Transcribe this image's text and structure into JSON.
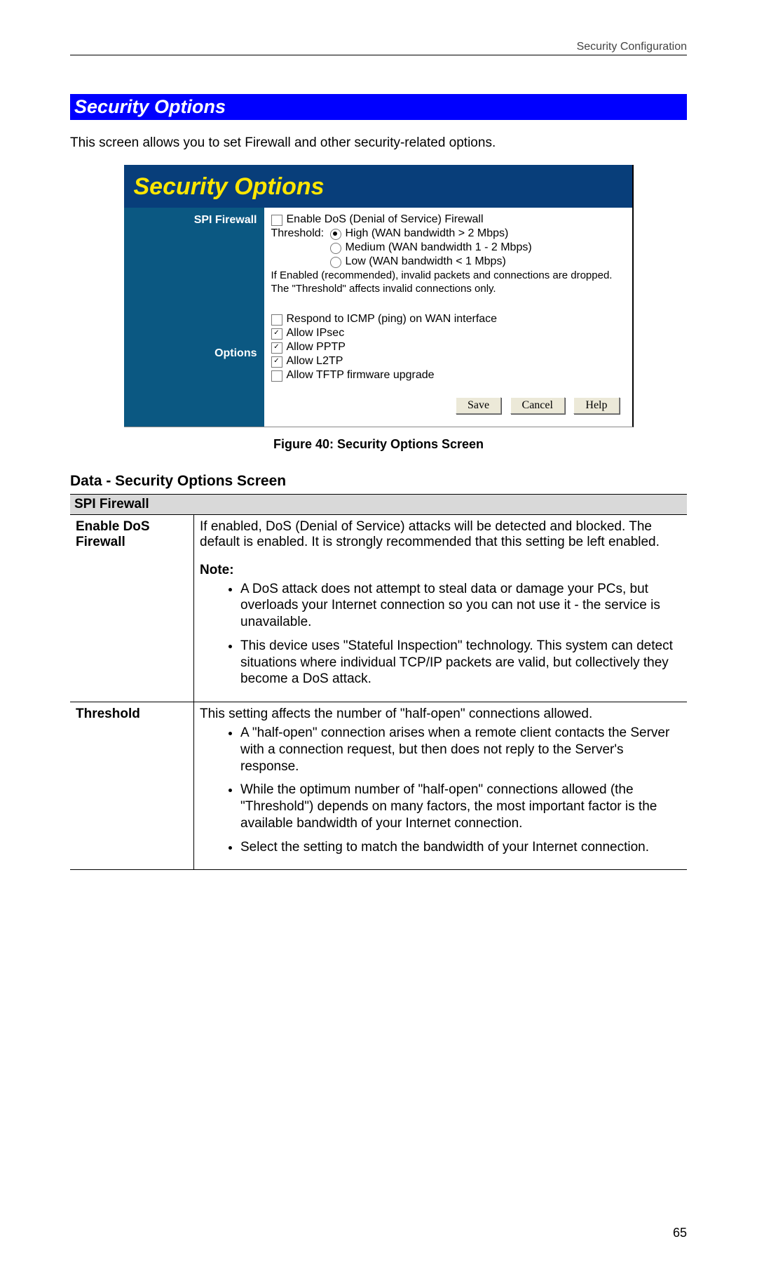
{
  "header": {
    "chapter": "Security Configuration"
  },
  "section_title": "Security Options",
  "intro": "This screen allows you to set Firewall and other security-related options.",
  "screencap": {
    "title": "Security Options",
    "left": {
      "row1": "SPI Firewall",
      "row2": "Options"
    },
    "spi": {
      "enable_label": "Enable DoS (Denial of Service) Firewall",
      "thresh_label": "Threshold:",
      "r_high": "High (WAN bandwidth > 2 Mbps)",
      "r_med": "Medium (WAN bandwidth 1 - 2 Mbps)",
      "r_low": "Low (WAN bandwidth < 1 Mbps)",
      "note": "If Enabled (recommended), invalid packets and connections are dropped. The \"Threshold\" affects invalid connections only."
    },
    "opts": {
      "o1": "Respond to ICMP (ping) on WAN interface",
      "o2": "Allow IPsec",
      "o3": "Allow PPTP",
      "o4": "Allow L2TP",
      "o5": "Allow TFTP firmware upgrade"
    },
    "buttons": {
      "save": "Save",
      "cancel": "Cancel",
      "help": "Help"
    }
  },
  "figcap": "Figure 40: Security Options Screen",
  "subhead": "Data - Security Options Screen",
  "table": {
    "bar": "SPI Firewall",
    "row1": {
      "label": "Enable DoS Firewall",
      "desc": "If enabled, DoS (Denial of Service) attacks will be detected and blocked. The default is enabled. It is strongly recommended that this setting be left enabled.",
      "note_label": "Note:",
      "b1": "A DoS attack does not attempt to steal data or damage your PCs, but overloads your Internet connection so you can not use it - the service is unavailable.",
      "b2": "This device uses \"Stateful Inspection\" technology. This system can detect situations where individual TCP/IP packets are valid, but collectively they become a DoS attack."
    },
    "row2": {
      "label": "Threshold",
      "desc": "This setting affects the number of \"half-open\" connections allowed.",
      "b1": "A \"half-open\" connection arises when a remote client contacts the Server with a connection request, but then does not reply to the Server's response.",
      "b2": "While the optimum number of \"half-open\" connections allowed (the \"Threshold\") depends on many factors, the most important factor is the available bandwidth of your Internet connection.",
      "b3": "Select the setting to match the bandwidth of your Internet connection."
    }
  },
  "pageno": "65"
}
